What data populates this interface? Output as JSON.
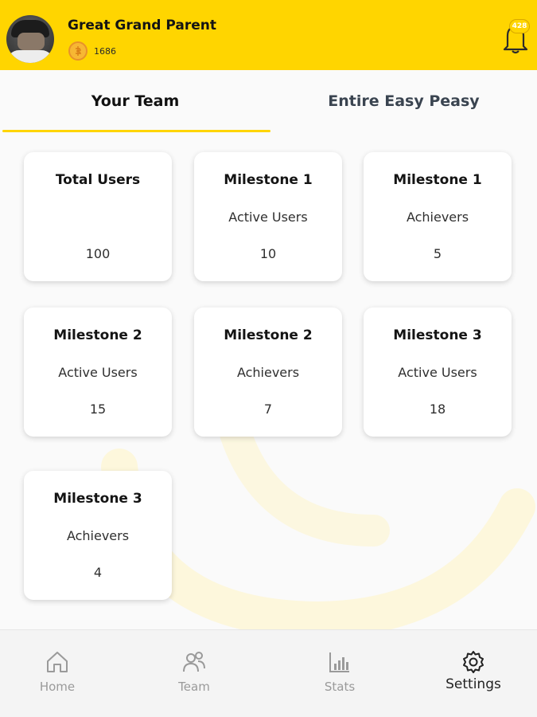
{
  "header": {
    "user_name": "Great Grand Parent",
    "coins": "1686",
    "notification_count": "428",
    "background_color": "#ffd500"
  },
  "tabs": [
    {
      "label": "Your Team",
      "active": true
    },
    {
      "label": "Entire Easy Peasy",
      "active": false
    }
  ],
  "cards": [
    {
      "title": "Total Users",
      "subtitle": "",
      "value": "100"
    },
    {
      "title": "Milestone 1",
      "subtitle": "Active Users",
      "value": "10"
    },
    {
      "title": "Milestone 1",
      "subtitle": "Achievers",
      "value": "5"
    },
    {
      "title": "Milestone 2",
      "subtitle": "Active Users",
      "value": "15"
    },
    {
      "title": "Milestone 2",
      "subtitle": "Achievers",
      "value": "7"
    },
    {
      "title": "Milestone 3",
      "subtitle": "Active Users",
      "value": "18"
    },
    {
      "title": "Milestone 3",
      "subtitle": "Achievers",
      "value": "4"
    }
  ],
  "bottom_nav": [
    {
      "label": "Home",
      "icon": "home-icon",
      "active": false
    },
    {
      "label": "Team",
      "icon": "team-icon",
      "active": false
    },
    {
      "label": "Stats",
      "icon": "stats-icon",
      "active": false
    },
    {
      "label": "Settings",
      "icon": "gear-icon",
      "active": true
    }
  ]
}
